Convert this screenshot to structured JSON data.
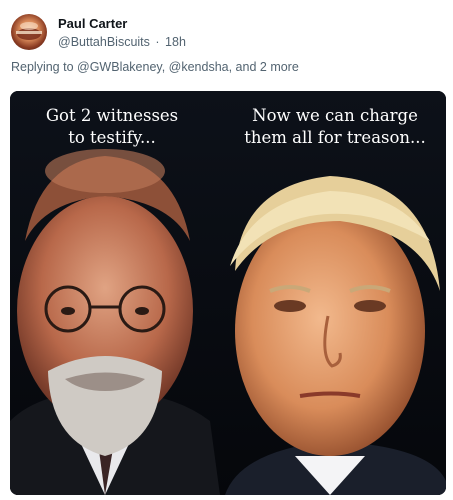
{
  "post": {
    "author_name": "Paul Carter",
    "handle": "@ButtahBiscuits",
    "separator": "·",
    "timestamp": "18h",
    "reply_prefix": "Replying to ",
    "reply_to": "@GWBlakeney, @kendsha, and 2 more"
  },
  "image": {
    "caption_left": "Got 2 witnesses\nto testify...",
    "caption_right": "Now we can charge\nthem all for treason..."
  },
  "colors": {
    "text_primary": "#0f1419",
    "text_secondary": "#536471",
    "image_background": "#0b0e14"
  }
}
